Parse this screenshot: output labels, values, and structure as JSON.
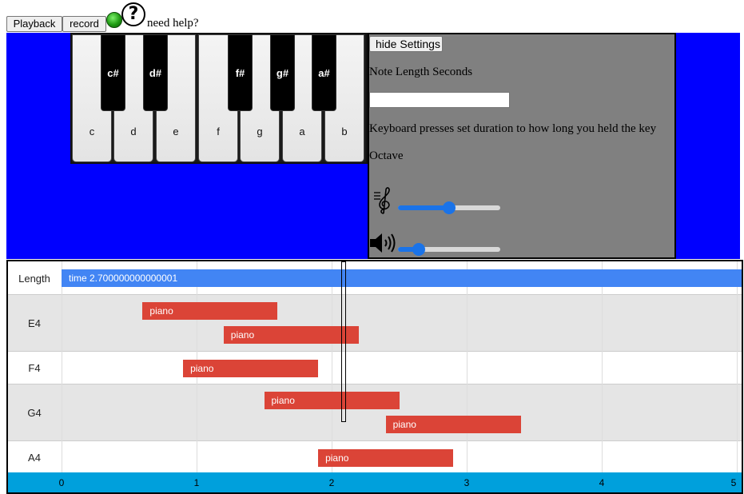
{
  "toolbar": {
    "playback_label": "Playback",
    "record_label": "record",
    "status_indicator": "green",
    "help_icon": "question-mark-icon",
    "help_text": "need help?"
  },
  "keyboard": {
    "white_keys": [
      "c",
      "d",
      "e",
      "f",
      "g",
      "a",
      "b"
    ],
    "black_keys": [
      "c#",
      "d#",
      "f#",
      "g#",
      "a#"
    ]
  },
  "settings": {
    "hide_button_label": "hide Settings",
    "note_length_label": "Note Length Seconds",
    "note_length_value": "",
    "keyboard_hint": "Keyboard presses set duration to how long you held the key",
    "octave_label": "Octave",
    "octave_icon": "treble-clef-icon",
    "octave_slider_value": 0.5,
    "volume_icon": "speaker-icon",
    "volume_slider_value": 0.2
  },
  "timeline": {
    "rows": [
      {
        "label": "Length"
      },
      {
        "label": "E4"
      },
      {
        "label": "F4"
      },
      {
        "label": "G4"
      },
      {
        "label": "A4"
      }
    ],
    "length_bar_label": "time 2.700000000000001",
    "note_label": "piano",
    "notes": [
      {
        "row": "E4",
        "start": 0.6,
        "end": 1.6,
        "label": "piano"
      },
      {
        "row": "E4",
        "start": 1.2,
        "end": 2.2,
        "label": "piano"
      },
      {
        "row": "F4",
        "start": 0.9,
        "end": 1.9,
        "label": "piano"
      },
      {
        "row": "G4",
        "start": 1.5,
        "end": 2.5,
        "label": "piano"
      },
      {
        "row": "G4",
        "start": 2.4,
        "end": 3.4,
        "label": "piano"
      },
      {
        "row": "A4",
        "start": 1.9,
        "end": 2.9,
        "label": "piano"
      }
    ],
    "axis_ticks": [
      "0",
      "1",
      "2",
      "3",
      "4",
      "5"
    ],
    "playhead_time": 2.1,
    "colors": {
      "note": "#db4437",
      "length": "#4285f4",
      "axis": "#00a0dc"
    }
  }
}
